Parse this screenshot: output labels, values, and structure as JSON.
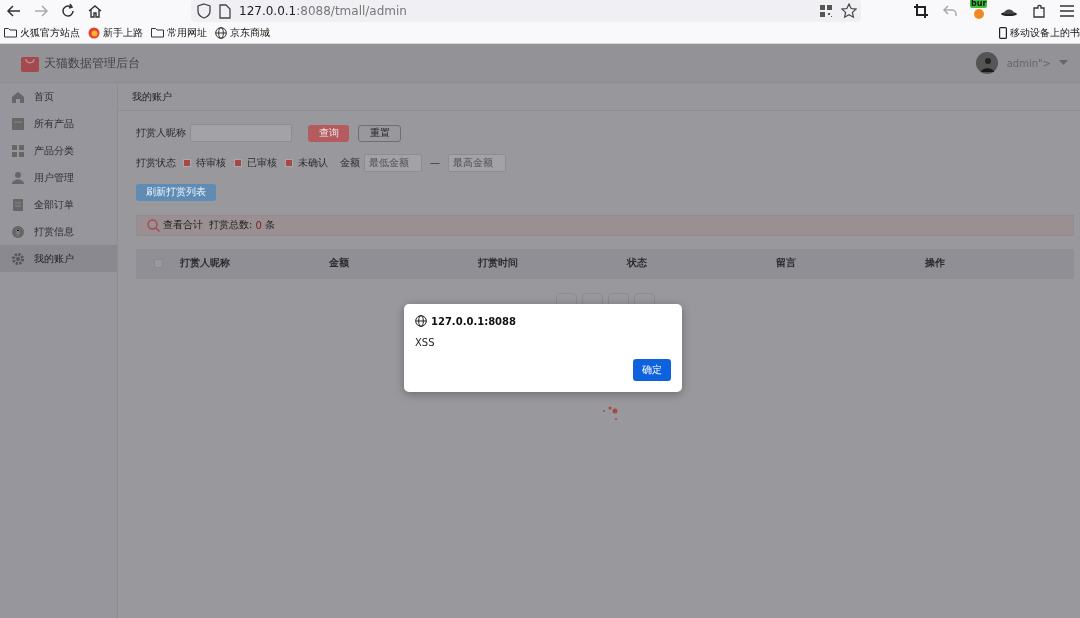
{
  "browser": {
    "url": {
      "host": "127.0.0.1",
      "path": ":8088/tmall/admin"
    },
    "extension_badge": "bur",
    "bookmarks": [
      {
        "label": "火狐官方站点",
        "kind": "folder"
      },
      {
        "label": "新手上路",
        "kind": "firefox"
      },
      {
        "label": "常用网址",
        "kind": "folder"
      },
      {
        "label": "京东商城",
        "kind": "globe"
      }
    ],
    "mobile_bookmarks": "移动设备上的书"
  },
  "app": {
    "title": "天猫数据管理后台",
    "user": "admin\">",
    "sidebar": {
      "items": [
        {
          "label": "首页",
          "selected": false
        },
        {
          "label": "所有产品",
          "selected": false
        },
        {
          "label": "产品分类",
          "selected": false
        },
        {
          "label": "用户管理",
          "selected": false
        },
        {
          "label": "全部订单",
          "selected": false
        },
        {
          "label": "打赏信息",
          "selected": false
        },
        {
          "label": "我的账户",
          "selected": true
        }
      ]
    },
    "breadcrumb": "我的账户",
    "filters": {
      "nickname_label": "打赏人昵称",
      "query_button": "查询",
      "reset_button": "重置",
      "status_label": "打赏状态",
      "statuses": [
        {
          "label": "待审核",
          "checked": true
        },
        {
          "label": "已审核",
          "checked": true
        },
        {
          "label": "未确认",
          "checked": true
        }
      ],
      "amount_label": "金额",
      "min_amount": {
        "placeholder": "最低金额"
      },
      "range_dash": "—",
      "max_amount": {
        "placeholder": "最高金额"
      },
      "refresh_button": "刷新打赏列表"
    },
    "summary": {
      "label": "查看合计",
      "total_label": "打赏总数:",
      "total": "0",
      "unit": "条"
    },
    "table": {
      "select_all_checked": false,
      "columns": [
        "打赏人昵称",
        "金额",
        "打赏时间",
        "状态",
        "留言",
        "操作"
      ]
    }
  },
  "dialog": {
    "origin": "127.0.0.1:8088",
    "message": "XSS",
    "ok_button": "确定"
  }
}
